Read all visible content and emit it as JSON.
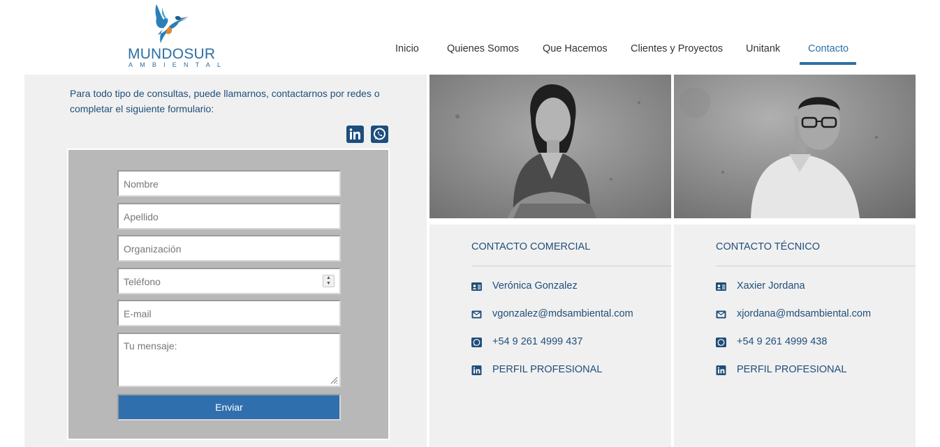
{
  "brand": {
    "name": "MUNDOSUR",
    "tagline": "AMBIENTAL"
  },
  "nav": {
    "items": [
      {
        "label": "Inicio",
        "active": false
      },
      {
        "label": "Quienes Somos",
        "active": false
      },
      {
        "label": "Que Hacemos",
        "active": false
      },
      {
        "label": "Clientes y Proyectos",
        "active": false
      },
      {
        "label": "Unitank",
        "active": false
      },
      {
        "label": "Contacto",
        "active": true
      }
    ]
  },
  "intro": {
    "text": "Para todo tipo de consultas, puede llamarnos, contactarnos por redes o completar el siguiente formulario:"
  },
  "social": {
    "linkedin_icon": "linkedin-icon",
    "whatsapp_icon": "whatsapp-icon"
  },
  "form": {
    "nombre_placeholder": "Nombre",
    "apellido_placeholder": "Apellido",
    "organizacion_placeholder": "Organización",
    "telefono_placeholder": "Teléfono",
    "email_placeholder": "E-mail",
    "mensaje_placeholder": "Tu mensaje:",
    "submit_label": "Enviar"
  },
  "contacts": [
    {
      "title": "CONTACTO COMERCIAL",
      "name": "Verónica Gonzalez",
      "email": "vgonzalez@mdsambiental.com",
      "phone": "+54 9 261 4999 437",
      "profile": "PERFIL PROFESIONAL"
    },
    {
      "title": "CONTACTO TÉCNICO",
      "name": "Xaxier Jordana",
      "email": "xjordana@mdsambiental.com",
      "phone": "+54 9 261 4999 438",
      "profile": "PERFIL PROFESIONAL"
    }
  ],
  "colors": {
    "accent": "#2e6fa7",
    "text_dark_blue": "#1f4e79",
    "panel_bg": "#f0f0f0",
    "form_bg": "#b8b8b8",
    "button_bg": "#2f6fad"
  }
}
